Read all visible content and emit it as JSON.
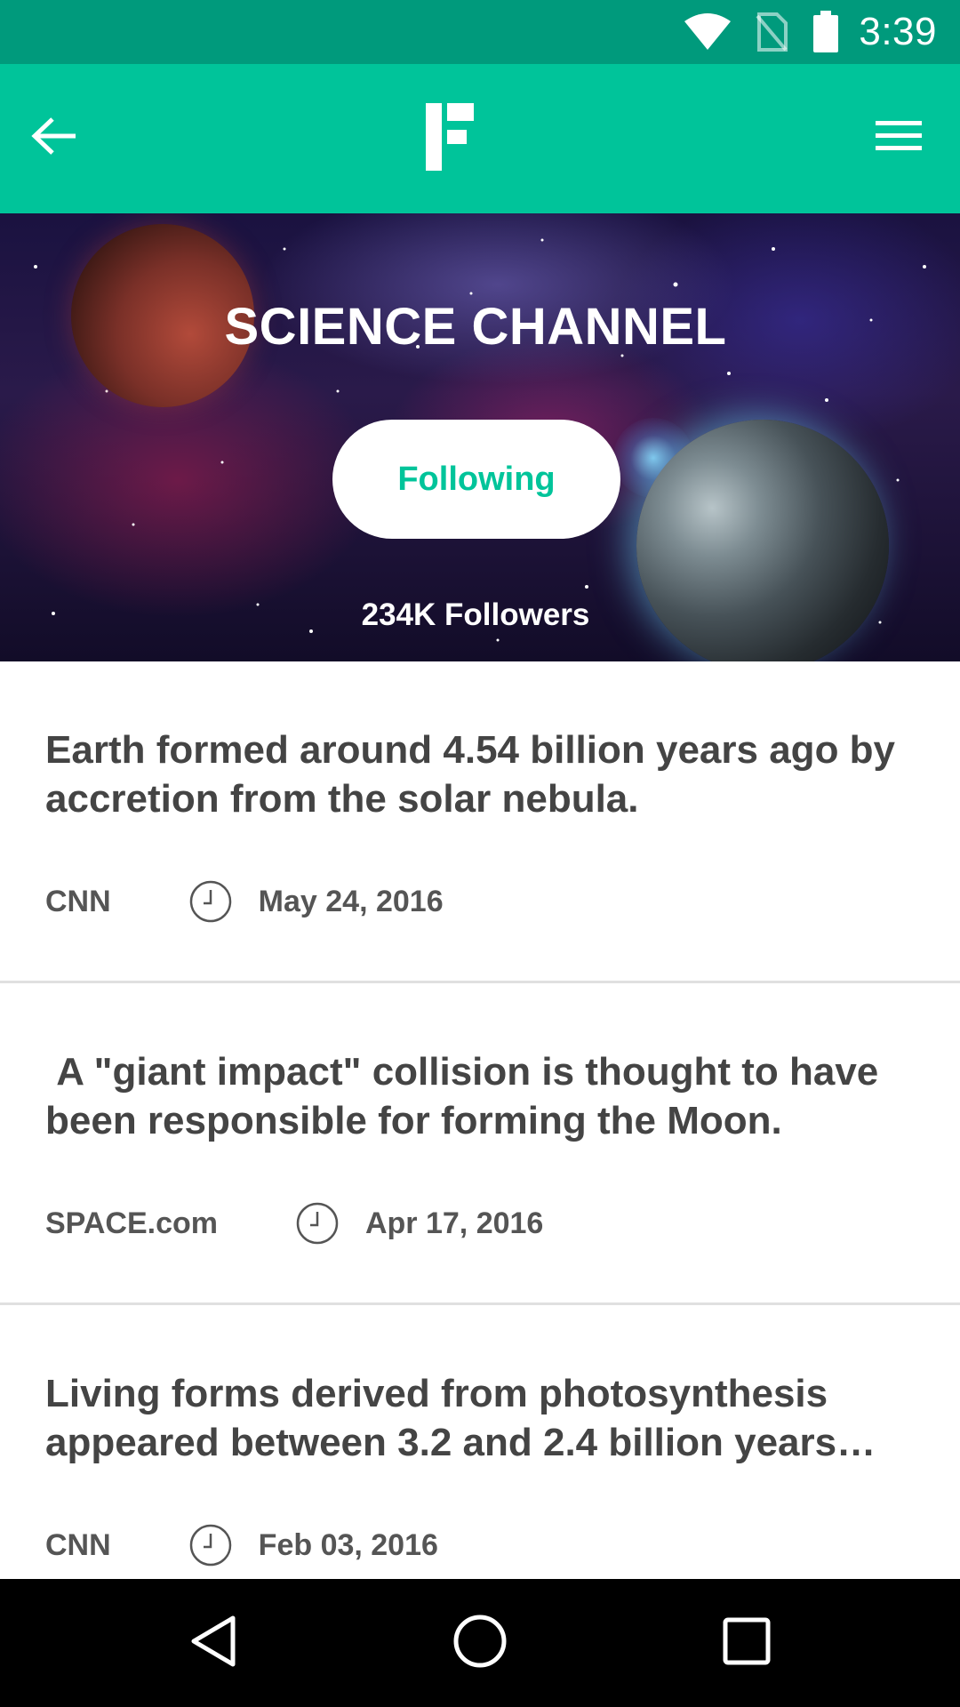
{
  "status_bar": {
    "time": "3:39",
    "icons": [
      "wifi-icon",
      "no-sim-icon",
      "battery-icon"
    ]
  },
  "app_bar": {
    "back_icon": "arrow-left-icon",
    "logo": "F",
    "menu_icon": "hamburger-menu-icon",
    "background": "#00c49a"
  },
  "channel": {
    "title": "SCIENCE CHANNEL",
    "follow_button_label": "Following",
    "followers_text": "234K Followers"
  },
  "articles": [
    {
      "headline": "Earth formed around 4.54 billion years ago by accretion from the solar nebula.",
      "source": "CNN",
      "date": "May 24, 2016"
    },
    {
      "headline": " A \"giant impact\" collision is thought to have been responsible for forming the Moon.",
      "source": "SPACE.com",
      "date": "Apr 17, 2016"
    },
    {
      "headline": "Living forms derived from photosynthesis appeared between 3.2 and 2.4 billion years…",
      "source": "CNN",
      "date": "Feb 03, 2016"
    }
  ],
  "nav_bar": {
    "icons": [
      "back-triangle-icon",
      "home-circle-icon",
      "recents-square-icon"
    ]
  },
  "colors": {
    "status_bar": "#009a7c",
    "accent": "#00c49a",
    "text_dark": "#444444"
  }
}
